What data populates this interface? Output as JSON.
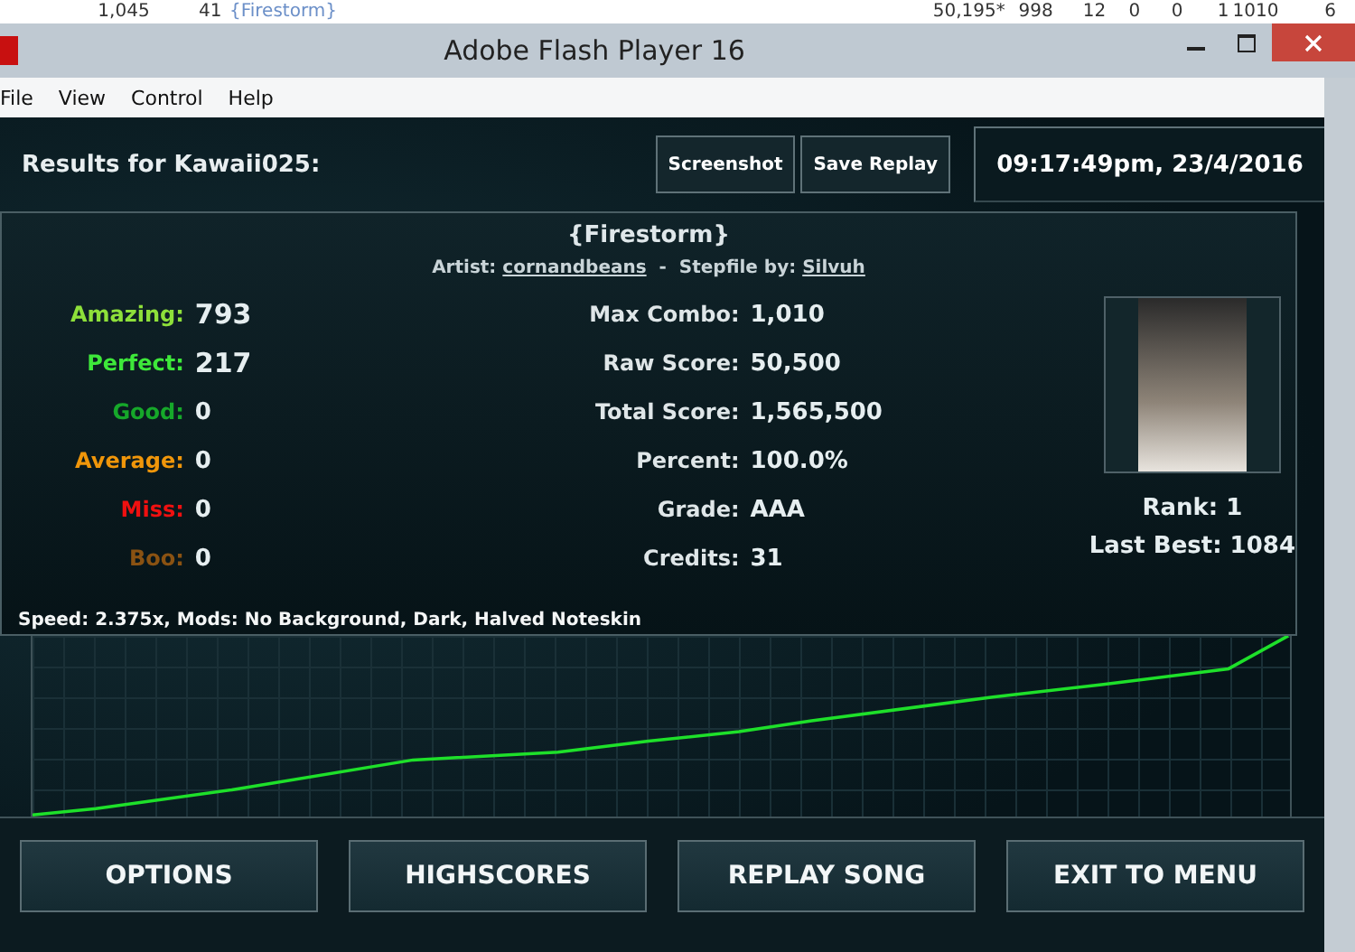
{
  "background_row": {
    "cells": [
      "1,045",
      "41",
      "{Firestorm}",
      "50,195*",
      "998",
      "12",
      "0",
      "0",
      "1",
      "1010",
      "6"
    ]
  },
  "window": {
    "title": "Adobe Flash Player 16"
  },
  "menu": [
    "File",
    "View",
    "Control",
    "Help"
  ],
  "header": {
    "title": "Results for Kawaii025:",
    "buttons": [
      "Screenshot",
      "Save Replay"
    ],
    "timestamp": "09:17:49pm, 23/4/2016"
  },
  "song": {
    "title": "{Firestorm}",
    "artist_label": "Artist:",
    "artist": "cornandbeans",
    "separator": "-",
    "stepfile_label": "Stepfile by:",
    "stepfile": "Silvuh"
  },
  "judgements": [
    {
      "label": "Amazing:",
      "value": "793",
      "color": "#8ee03a"
    },
    {
      "label": "Perfect:",
      "value": "217",
      "color": "#3ee83a"
    },
    {
      "label": "Good:",
      "value": "0",
      "color": "#16a82a"
    },
    {
      "label": "Average:",
      "value": "0",
      "color": "#f0960a"
    },
    {
      "label": "Miss:",
      "value": "0",
      "color": "#f01010"
    },
    {
      "label": "Boo:",
      "value": "0",
      "color": "#8a5212"
    }
  ],
  "stats": [
    {
      "label": "Max Combo:",
      "value": "1,010"
    },
    {
      "label": "Raw Score:",
      "value": "50,500"
    },
    {
      "label": "Total Score:",
      "value": "1,565,500"
    },
    {
      "label": "Percent:",
      "value": "100.0%"
    },
    {
      "label": "Grade:",
      "value": "AAA"
    },
    {
      "label": "Credits:",
      "value": "31"
    }
  ],
  "rank": "Rank: 1",
  "last_best": "Last Best: 1084",
  "settings": "Speed: 2.375x, Mods: No Background, Dark, Halved Noteskin",
  "buttons": [
    "OPTIONS",
    "HIGHSCORES",
    "REPLAY SONG",
    "EXIT TO MENU"
  ]
}
